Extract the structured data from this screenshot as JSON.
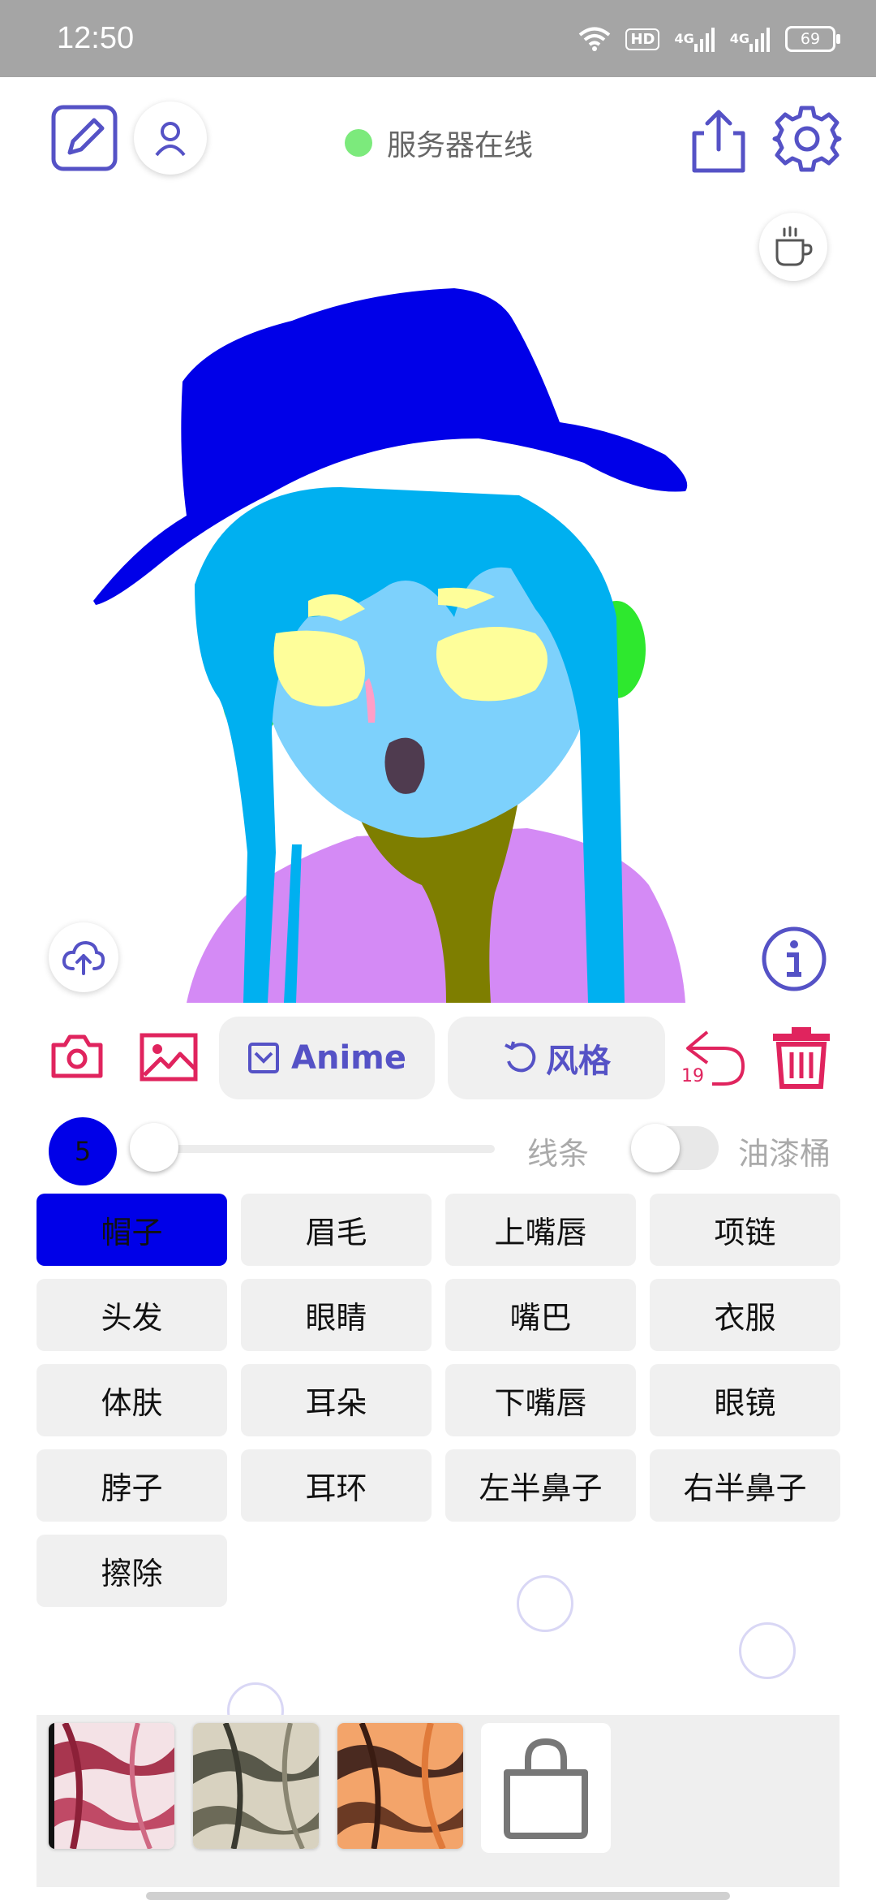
{
  "status_bar": {
    "time": "12:50",
    "hd_label": "HD",
    "net1_label": "4G",
    "net2_label": "4G",
    "battery": "69"
  },
  "toolbar": {
    "edit_icon": "pencil-square-icon",
    "user_icon": "user-icon",
    "server_status": "服务器在线",
    "server_status_color": "#7cea7c",
    "share_icon": "share-icon",
    "settings_icon": "gear-icon",
    "coffee_icon": "coffee-icon"
  },
  "canvas": {
    "upload_icon": "cloud-upload-icon",
    "info_icon": "info-icon"
  },
  "tools": {
    "camera_icon": "camera-icon",
    "gallery_icon": "image-icon",
    "anime_label": "Anime",
    "style_label": "风格",
    "undo_count": "19",
    "undo_icon": "undo-icon",
    "delete_icon": "trash-icon",
    "accent_color": "#e0245e",
    "primary_color": "#5552c6"
  },
  "brush": {
    "size": "5",
    "size_fraction": 0.0,
    "line_label": "线条",
    "bucket_label": "油漆桶",
    "bucket_enabled": false
  },
  "parts": [
    {
      "label": "帽子",
      "active": true
    },
    {
      "label": "眉毛",
      "active": false
    },
    {
      "label": "上嘴唇",
      "active": false
    },
    {
      "label": "项链",
      "active": false
    },
    {
      "label": "头发",
      "active": false
    },
    {
      "label": "眼睛",
      "active": false
    },
    {
      "label": "嘴巴",
      "active": false
    },
    {
      "label": "衣服",
      "active": false
    },
    {
      "label": "体肤",
      "active": false
    },
    {
      "label": "耳朵",
      "active": false
    },
    {
      "label": "下嘴唇",
      "active": false
    },
    {
      "label": "眼镜",
      "active": false
    },
    {
      "label": "脖子",
      "active": false
    },
    {
      "label": "耳环",
      "active": false
    },
    {
      "label": "左半鼻子",
      "active": false
    },
    {
      "label": "右半鼻子",
      "active": false
    },
    {
      "label": "擦除",
      "active": false
    }
  ],
  "textures": {
    "items": [
      "red-marble-texture",
      "grey-marble-texture",
      "orange-marble-texture"
    ],
    "shop_icon": "shopping-bag-icon"
  }
}
